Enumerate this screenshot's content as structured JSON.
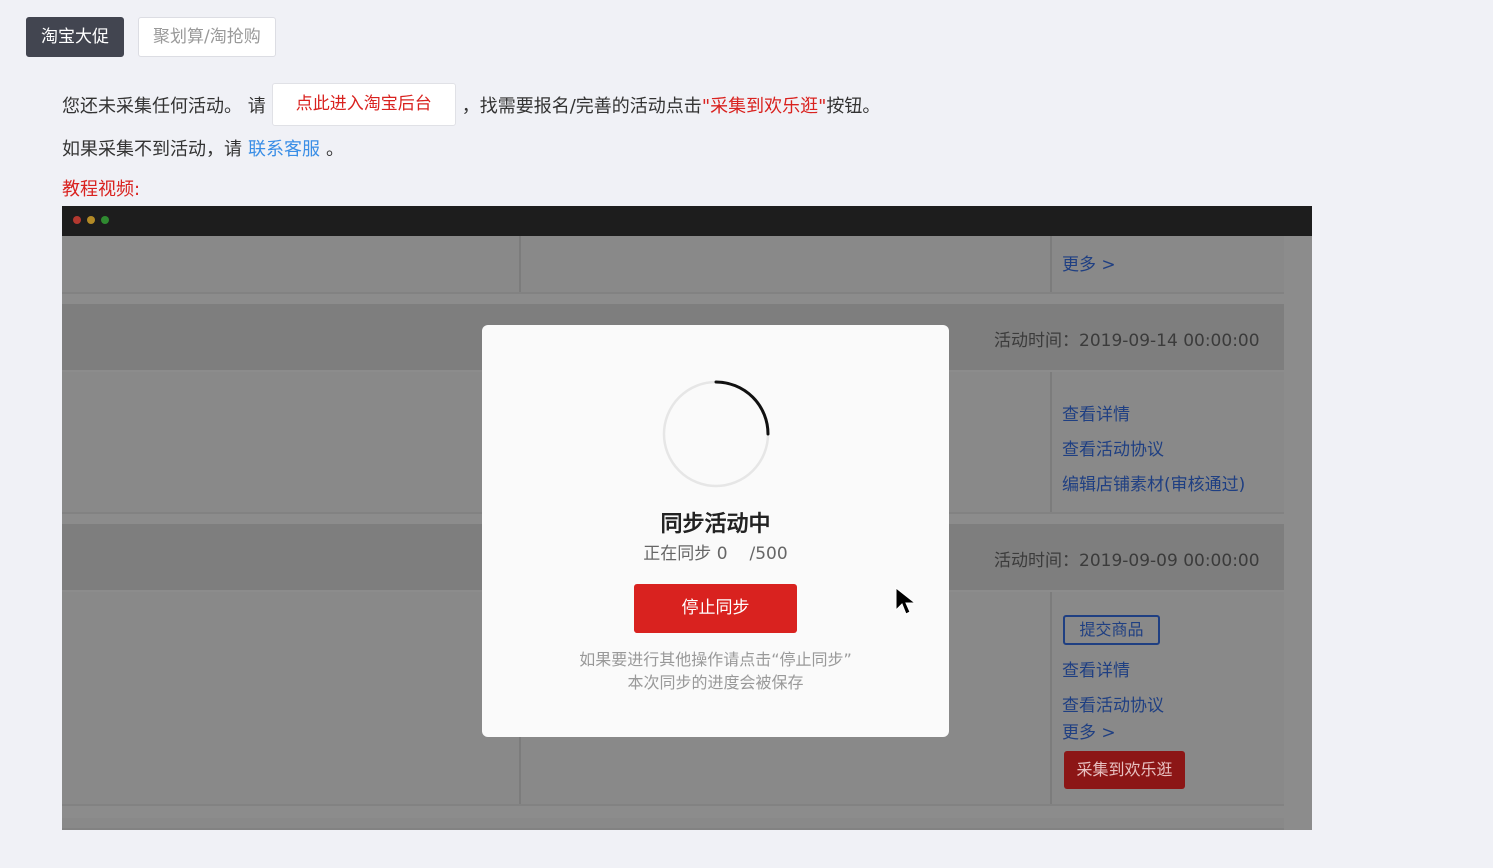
{
  "tabs": [
    {
      "label": "淘宝大促",
      "active": true
    },
    {
      "label": "聚划算/淘抢购",
      "active": false
    }
  ],
  "intro": {
    "text_before": "您还未采集任何活动。 请",
    "backend_button": "点此进入淘宝后台",
    "text_middle": "，找需要报名/完善的活动点击",
    "collect_quote": "\"采集到欢乐逛\"",
    "text_after": "按钮。"
  },
  "support": {
    "text_before": "如果采集不到活动，请",
    "link": "联系客服",
    "text_after": "。"
  },
  "tutorial_label": "教程视频:",
  "video": {
    "screen": {
      "more_1": "更多 >",
      "activity_time_1": "活动时间：2019-09-14 00:00:00",
      "links_1": [
        "查看详情",
        "查看活动协议",
        "编辑店铺素材(审核通过)"
      ],
      "activity_time_2": "活动时间：2019-09-09 00:00:00",
      "submit_goods": "提交商品",
      "links_2": [
        "查看详情",
        "查看活动协议"
      ],
      "more_2": "更多 >",
      "collect_button": "采集到欢乐逛"
    },
    "modal": {
      "title": "同步活动中",
      "progress_prefix": "正在同步",
      "progress_current": "0",
      "progress_total": "/500",
      "stop_button": "停止同步",
      "hint_line1": "如果要进行其他操作请点击“停止同步”",
      "hint_line2": "本次同步的进度会被保存"
    }
  },
  "colors": {
    "accent_red": "#d9221f",
    "link_blue": "#3a8ee6",
    "active_tab": "#424550"
  }
}
